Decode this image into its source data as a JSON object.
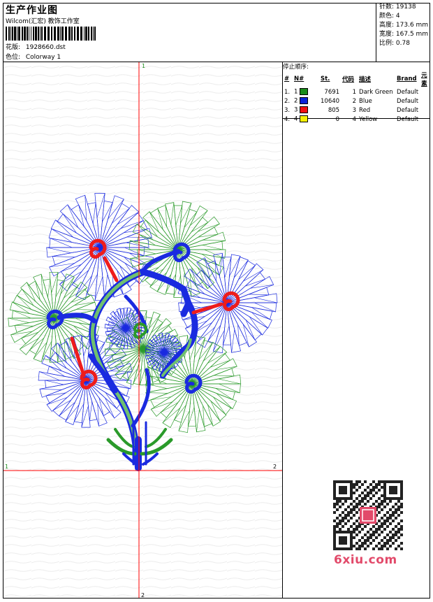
{
  "header": {
    "title": "生产作业图",
    "company": "Wilcom(汇宏) 教饰工作室",
    "design_label": "花版:",
    "design_value": "1928660.dst",
    "colorway_label": "色位:",
    "colorway_value": "Colorway 1"
  },
  "stats": [
    {
      "label": "针数:",
      "value": "19138"
    },
    {
      "label": "颜色:",
      "value": "4"
    },
    {
      "label": "高度:",
      "value": "173.6 mm"
    },
    {
      "label": "宽度:",
      "value": "167.5 mm"
    },
    {
      "label": "比例:",
      "value": "0.78"
    }
  ],
  "canvas": {
    "marker_top": "1",
    "marker_left": "1",
    "marker_right": "2",
    "marker_bottom": "2"
  },
  "stop_sequence": {
    "caption": "停止顺序:",
    "columns": [
      "#",
      "N#",
      "St.",
      "代码",
      "描述",
      "Brand",
      "元素"
    ],
    "rows": [
      {
        "idx": "1.",
        "n": "1",
        "color": "#1a8c1a",
        "st": "7691",
        "code": "1",
        "desc": "Dark Green",
        "brand": "Default"
      },
      {
        "idx": "2.",
        "n": "2",
        "color": "#0a22d8",
        "st": "10640",
        "code": "2",
        "desc": "Blue",
        "brand": "Default"
      },
      {
        "idx": "3.",
        "n": "3",
        "color": "#f01010",
        "st": "805",
        "code": "3",
        "desc": "Red",
        "brand": "Default"
      },
      {
        "idx": "4.",
        "n": "4",
        "color": "#f4f000",
        "st": "0",
        "code": "4",
        "desc": "Yellow",
        "brand": "Default"
      }
    ]
  },
  "watermark": {
    "site": "6xiu.com"
  },
  "colors": {
    "green": "#2a9a2a",
    "blue": "#1a2ae0",
    "red": "#ee1c1c",
    "guide": "#ff0000"
  }
}
